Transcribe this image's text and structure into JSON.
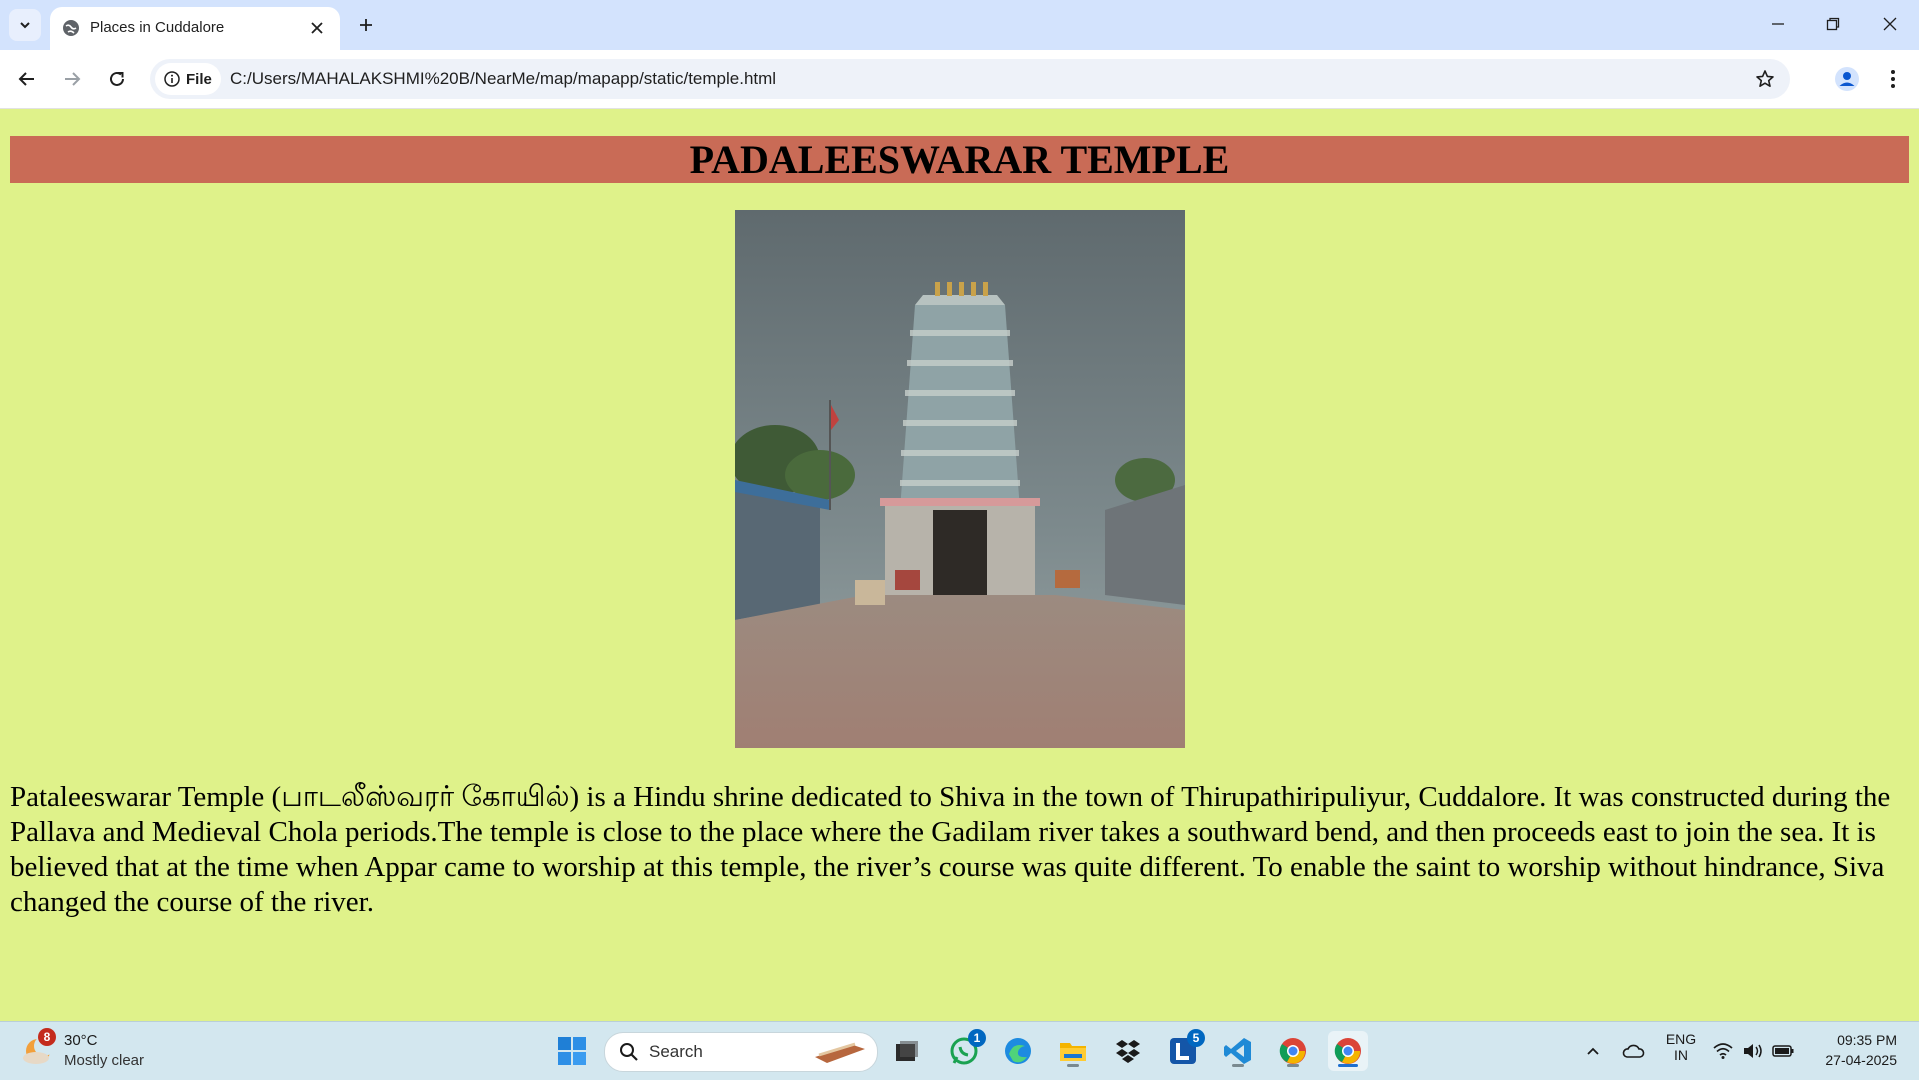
{
  "browser": {
    "tab_title": "Places in Cuddalore",
    "chip_label": "File",
    "url": "C:/Users/MAHALAKSHMI%20B/NearMe/map/mapapp/static/temple.html"
  },
  "page": {
    "heading": "PADALEESWARAR TEMPLE",
    "paragraph": "Pataleeswarar Temple (பாடலீஸ்வரர் கோயில்) is a Hindu shrine dedicated to Shiva in the town of Thirupathiripuliyur, Cuddalore. It was constructed during the Pallava and Medieval Chola periods.The temple is close to the place where the Gadilam river takes a southward bend, and then proceeds east to join the sea. It is believed that at the time when Appar came to worship at this temple, the river’s course was quite different. To enable the saint to worship without hindrance, Siva changed the course of the river."
  },
  "taskbar": {
    "weather_badge": "8",
    "weather_temp": "30°C",
    "weather_desc": "Mostly clear",
    "search_label": "Search",
    "whatsapp_badge": "1",
    "l_app_badge": "5",
    "lang_top": "ENG",
    "lang_bottom": "IN",
    "time": "09:35 PM",
    "date": "27-04-2025"
  },
  "colors": {
    "page_background": "#dff28a",
    "heading_background": "#c96b56",
    "tabbar": "#d3e3fd"
  }
}
